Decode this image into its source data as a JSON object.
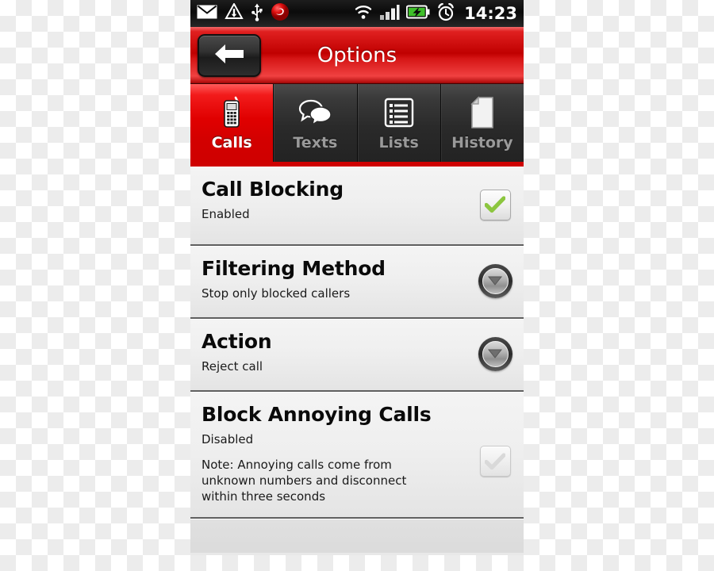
{
  "statusbar": {
    "icons_left": [
      "mail-icon",
      "sync-upload-icon",
      "usb-icon",
      "app-badge-icon"
    ],
    "icons_right": [
      "wifi-icon",
      "signal-icon",
      "battery-charging-icon",
      "alarm-icon"
    ],
    "time": "14:23"
  },
  "header": {
    "title": "Options",
    "back_icon": "back-arrow-icon"
  },
  "tabs": [
    {
      "label": "Calls",
      "icon": "phone-icon",
      "active": true
    },
    {
      "label": "Texts",
      "icon": "chat-bubbles-icon",
      "active": false
    },
    {
      "label": "Lists",
      "icon": "list-icon",
      "active": false
    },
    {
      "label": "History",
      "icon": "document-icon",
      "active": false
    }
  ],
  "settings": [
    {
      "title": "Call Blocking",
      "subtitle": "Enabled",
      "note": "",
      "control": "checkbox",
      "checked": true,
      "disabled": false
    },
    {
      "title": "Filtering Method",
      "subtitle": "Stop only blocked callers",
      "note": "",
      "control": "dropdown",
      "checked": false,
      "disabled": false
    },
    {
      "title": "Action",
      "subtitle": "Reject call",
      "note": "",
      "control": "dropdown",
      "checked": false,
      "disabled": false
    },
    {
      "title": "Block Annoying Calls",
      "subtitle": "Disabled",
      "note": "Note: Annoying calls come from unknown numbers and disconnect within three seconds",
      "control": "checkbox",
      "checked": false,
      "disabled": true
    }
  ],
  "colors": {
    "brand_red": "#cc0000",
    "header_red": "#e02020",
    "check_green": "#8cc63f",
    "tab_inactive_text": "#9a9a9a",
    "row_bg": "#efefef",
    "status_bar": "#0b0b0b"
  }
}
